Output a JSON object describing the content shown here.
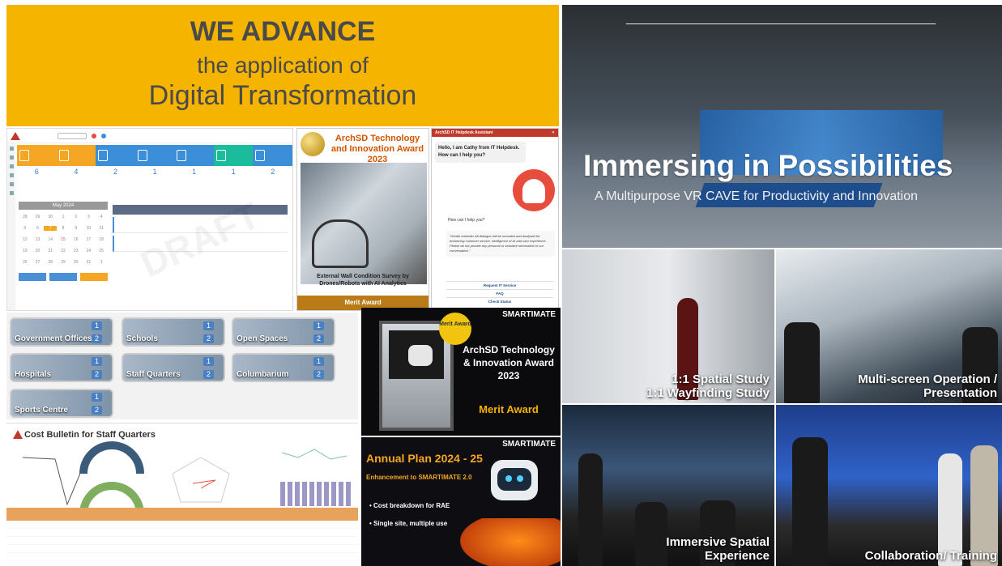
{
  "banner": {
    "line1": "WE ADVANCE",
    "line2": "the application of",
    "line3": "Digital Transformation"
  },
  "dashboard": {
    "month": "May 2024",
    "tile_colors": [
      "#f5a623",
      "#f5a623",
      "#3a8fd8",
      "#3a8fd8",
      "#3a8fd8",
      "#1abc9c",
      "#3a8fd8"
    ],
    "stats": [
      "6",
      "4",
      "2",
      "1",
      "1",
      "1",
      "2"
    ],
    "watermark": "DRAFT"
  },
  "award_survey": {
    "title": "ArchSD Technology and Innovation Award 2023",
    "caption": "External Wall Condition Survey by Drones/Robots with AI Analytics",
    "award": "Merit Award"
  },
  "chatbot": {
    "header": "ArchSD IT Helpdesk Assistant",
    "greeting": "Hello, I am Cathy from IT Helpdesk. How can I help you?",
    "question": "How can I help you?",
    "notice": "\"Gentle reminder All dialogue will be recorded and analysed for enhancing customer service, intelligence of AI and user experience. Please do not provide any personal or sensitive information in our conversation.\"",
    "links": [
      "Request IT Service",
      "FAQ",
      "Check Status"
    ]
  },
  "vr_cave": {
    "title": "Immersing in Possibilities",
    "subtitle": "A Multipurpose VR CAVE for Productivity and Innovation"
  },
  "photos": {
    "spatial_line1": "1:1 Spatial Study",
    "spatial_line2": "1:1 Wayfinding Study",
    "multiscreen_line1": "Multi-screen Operation /",
    "multiscreen_line2": "Presentation",
    "immersive_line1": "Immersive Spatial",
    "immersive_line2": "Experience",
    "collab": "Collaboration/ Training"
  },
  "categories": [
    {
      "name": "Government Offices"
    },
    {
      "name": "Schools"
    },
    {
      "name": "Open Spaces"
    },
    {
      "name": "Hospitals"
    },
    {
      "name": "Staff Quarters"
    },
    {
      "name": "Columbarium"
    },
    {
      "name": "Sports Centre"
    }
  ],
  "cost": {
    "title": "Cost Bulletin for Staff Quarters"
  },
  "smartimate_award": {
    "brand": "SMARTIMATE",
    "badge": "Merit Award",
    "award_title": "ArchSD Technology & Innovation Award 2023",
    "award": "Merit Award"
  },
  "annual_plan": {
    "brand": "SMARTIMATE",
    "title": "Annual Plan 2024 - 25",
    "subtitle": "Enhancement to SMARTIMATE 2.0",
    "bullet1": "Cost breakdown for RAE",
    "bullet2": "Single site, multiple use"
  }
}
